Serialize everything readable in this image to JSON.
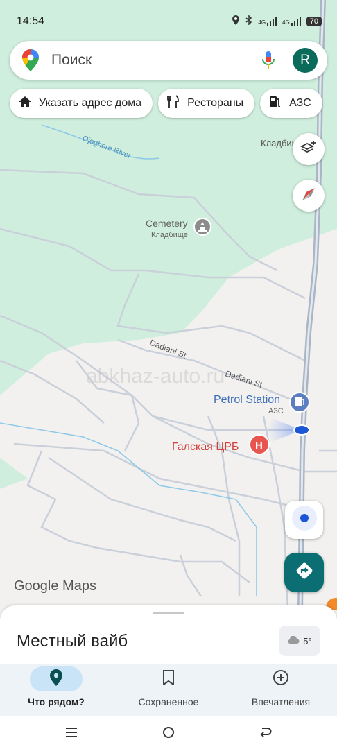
{
  "status_bar": {
    "time": "14:54",
    "network_1": "4G",
    "network_2": "4G",
    "battery": "70"
  },
  "search": {
    "placeholder": "Поиск",
    "avatar_letter": "R"
  },
  "chips": [
    {
      "label": "Указать адрес дома",
      "icon": "home-icon"
    },
    {
      "label": "Рестораны",
      "icon": "fork-knife-icon"
    },
    {
      "label": "АЗС",
      "icon": "fuel-icon"
    }
  ],
  "map": {
    "river_label": "Ojoghore River",
    "cemetery_top_label": "Кладбищ",
    "cemetery_en": "Cemetery",
    "cemetery_ru": "Кладбище",
    "street_1": "Dadiani St",
    "street_2": "Dadiani St",
    "petrol_en": "Petrol Station",
    "petrol_ru": "АЗС",
    "hospital": "Галская ЦРБ",
    "watermark": "abkhaz-auto.ru",
    "attribution": "Google Maps",
    "colors": {
      "forest": "#cfeedd",
      "land": "#f3f1ef",
      "road": "#c9d0da",
      "highway": "#aab6c6",
      "water": "#8ec9e8",
      "accent": "#0b6e73"
    }
  },
  "sheet": {
    "title": "Местный вайб",
    "weather": "5°"
  },
  "bottom_nav": [
    {
      "label": "Что рядом?",
      "icon": "location-pin-icon",
      "active": true
    },
    {
      "label": "Сохраненное",
      "icon": "bookmark-icon",
      "active": false
    },
    {
      "label": "Впечатления",
      "icon": "add-circle-icon",
      "active": false
    }
  ]
}
